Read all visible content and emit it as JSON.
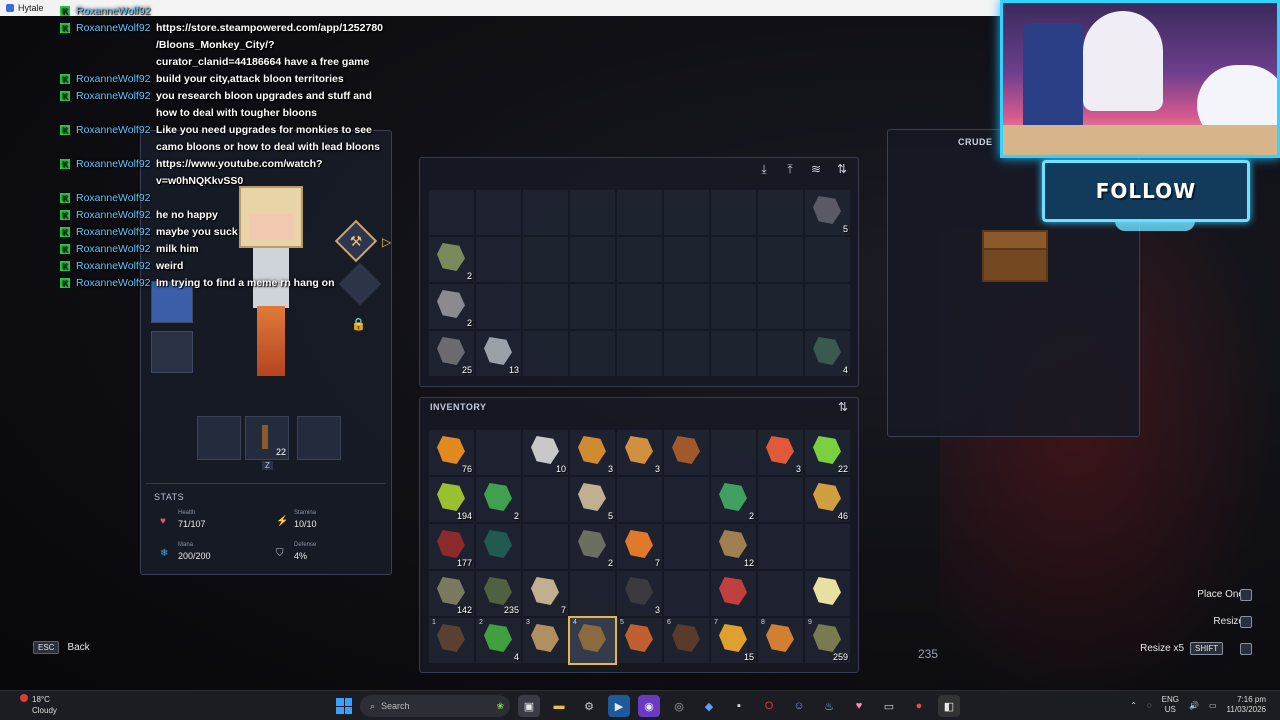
{
  "window": {
    "title": "Hytale",
    "controls": [
      "–",
      "☐",
      "✕"
    ]
  },
  "chat": [
    {
      "user": "RoxanneWolf92",
      "message": ""
    },
    {
      "user": "RoxanneWolf92",
      "message": "https://store.steampowered.com/app/1252780\n/Bloons_Monkey_City/?\ncurator_clanid=44186664 have a free game"
    },
    {
      "user": "RoxanneWolf92",
      "message": "build your city,attack bloon territories"
    },
    {
      "user": "RoxanneWolf92",
      "message": "you research bloon upgrades and stuff and\nhow to deal with tougher bloons"
    },
    {
      "user": "RoxanneWolf92",
      "message": "Like you need upgrades for monkies to see\ncamo bloons or how to deal with lead bloons"
    },
    {
      "user": "RoxanneWolf92",
      "message": "https://www.youtube.com/watch?\nv=w0hNQKkvSS0"
    },
    {
      "user": "RoxanneWolf92",
      "message": ""
    },
    {
      "user": "RoxanneWolf92",
      "message": "he no happy"
    },
    {
      "user": "RoxanneWolf92",
      "message": "maybe you suck"
    },
    {
      "user": "RoxanneWolf92",
      "message": "milk him"
    },
    {
      "user": "RoxanneWolf92",
      "message": "weird"
    },
    {
      "user": "RoxanneWolf92",
      "message": "Im trying to find a meme rn hang on"
    }
  ],
  "character": {
    "utility_count": "22",
    "utility_key": "Z"
  },
  "stats": {
    "title": "STATS",
    "health_label": "Health",
    "health": "71/107",
    "stamina_label": "Stamina",
    "stamina": "10/10",
    "mana_label": "Mana",
    "mana": "200/200",
    "defense_label": "Defense",
    "defense": "4%"
  },
  "storage": {
    "toolbar": [
      "download-icon",
      "upload-icon",
      "stack-icon",
      "sort-icon"
    ],
    "slots": [
      {
        "c": "",
        "col": ""
      },
      {
        "c": "",
        "col": ""
      },
      {
        "c": "",
        "col": ""
      },
      {
        "c": "",
        "col": ""
      },
      {
        "c": "",
        "col": ""
      },
      {
        "c": "",
        "col": ""
      },
      {
        "c": "",
        "col": ""
      },
      {
        "c": "",
        "col": ""
      },
      {
        "c": "5",
        "col": "#5a5a66"
      },
      {
        "c": "2",
        "col": "#7a8a5a"
      },
      {
        "c": "",
        "col": ""
      },
      {
        "c": "",
        "col": ""
      },
      {
        "c": "",
        "col": ""
      },
      {
        "c": "",
        "col": ""
      },
      {
        "c": "",
        "col": ""
      },
      {
        "c": "",
        "col": ""
      },
      {
        "c": "",
        "col": ""
      },
      {
        "c": "",
        "col": ""
      },
      {
        "c": "2",
        "col": "#8a8a90"
      },
      {
        "c": "",
        "col": ""
      },
      {
        "c": "",
        "col": ""
      },
      {
        "c": "",
        "col": ""
      },
      {
        "c": "",
        "col": ""
      },
      {
        "c": "",
        "col": ""
      },
      {
        "c": "",
        "col": ""
      },
      {
        "c": "",
        "col": ""
      },
      {
        "c": "",
        "col": ""
      },
      {
        "c": "25",
        "col": "#6a6a70"
      },
      {
        "c": "13",
        "col": "#9aa0a8"
      },
      {
        "c": "",
        "col": ""
      },
      {
        "c": "",
        "col": ""
      },
      {
        "c": "",
        "col": ""
      },
      {
        "c": "",
        "col": ""
      },
      {
        "c": "",
        "col": ""
      },
      {
        "c": "",
        "col": ""
      },
      {
        "c": "4",
        "col": "#3a5a50"
      }
    ]
  },
  "inventory": {
    "title": "INVENTORY",
    "slots": [
      {
        "c": "76",
        "col": "#e08a20"
      },
      {
        "c": "",
        "col": ""
      },
      {
        "c": "10",
        "col": "#c8c8c8"
      },
      {
        "c": "3",
        "col": "#d08a30"
      },
      {
        "c": "3",
        "col": "#d09040"
      },
      {
        "c": "",
        "col": "#a05a2a"
      },
      {
        "c": "",
        "col": ""
      },
      {
        "c": "3",
        "col": "#e05a3a"
      },
      {
        "c": "22",
        "col": "#7ad040"
      },
      {
        "c": "194",
        "col": "#9ac030"
      },
      {
        "c": "2",
        "col": "#40a050"
      },
      {
        "c": "",
        "col": ""
      },
      {
        "c": "5",
        "col": "#c0b090"
      },
      {
        "c": "",
        "col": ""
      },
      {
        "c": "",
        "col": ""
      },
      {
        "c": "2",
        "col": "#40a060"
      },
      {
        "c": "",
        "col": ""
      },
      {
        "c": "46",
        "col": "#d0a040"
      },
      {
        "c": "177",
        "col": "#8a2a2a"
      },
      {
        "c": "",
        "col": "#205a50"
      },
      {
        "c": "",
        "col": ""
      },
      {
        "c": "2",
        "col": "#6a7060"
      },
      {
        "c": "7",
        "col": "#e07a2a"
      },
      {
        "c": "",
        "col": ""
      },
      {
        "c": "12",
        "col": "#a08050"
      },
      {
        "c": "",
        "col": ""
      },
      {
        "c": "",
        "col": ""
      },
      {
        "c": "142",
        "col": "#7a7a60"
      },
      {
        "c": "235",
        "col": "#506040"
      },
      {
        "c": "7",
        "col": "#c0b090"
      },
      {
        "c": "",
        "col": ""
      },
      {
        "c": "3",
        "col": "#3a3a40"
      },
      {
        "c": "",
        "col": ""
      },
      {
        "c": "",
        "col": "#c04040"
      },
      {
        "c": "",
        "col": ""
      },
      {
        "c": "",
        "col": "#e8e0a0"
      },
      {
        "c": "",
        "col": "#5a4030",
        "hk": "1"
      },
      {
        "c": "4",
        "col": "#40a040",
        "hk": "2"
      },
      {
        "c": "",
        "col": "#b09060",
        "hk": "3"
      },
      {
        "c": "",
        "col": "#8a6a40",
        "hk": "4",
        "sel": true
      },
      {
        "c": "",
        "col": "#c06030",
        "hk": "5"
      },
      {
        "c": "",
        "col": "#5a3a2a",
        "hk": "6"
      },
      {
        "c": "15",
        "col": "#e0a030",
        "hk": "7"
      },
      {
        "c": "",
        "col": "#d08030",
        "hk": "8"
      },
      {
        "c": "259",
        "col": "#7a7a50",
        "hk": "9"
      }
    ]
  },
  "crude": {
    "title": "CRUDE"
  },
  "follow": {
    "label": "FOLLOW"
  },
  "hints": {
    "place_one": "Place One",
    "resize": "Resize",
    "resize_x5": "Resize x5",
    "shift": "SHIFT",
    "counter": "235"
  },
  "esc": {
    "key": "ESC",
    "label": "Back"
  },
  "taskbar": {
    "weather_temp": "18°C",
    "weather_desc": "Cloudy",
    "search_label": "Search",
    "lang_top": "ENG",
    "lang_bottom": "US",
    "time": "7:16 pm",
    "date": "11/03/2026"
  }
}
